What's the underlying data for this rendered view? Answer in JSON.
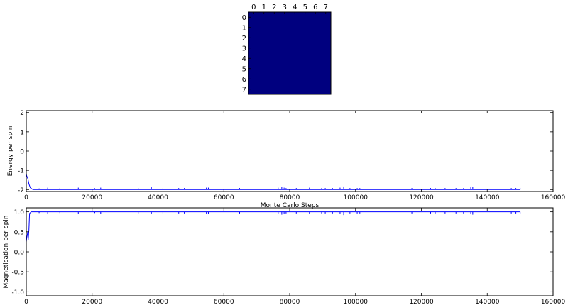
{
  "chart_data": [
    {
      "type": "heatmap",
      "title": "",
      "x_ticks": [
        "0",
        "1",
        "2",
        "3",
        "4",
        "5",
        "6",
        "7"
      ],
      "y_ticks": [
        "0",
        "1",
        "2",
        "3",
        "4",
        "5",
        "6",
        "7"
      ],
      "rows": 8,
      "cols": 8,
      "values": [
        [
          1,
          1,
          1,
          1,
          1,
          1,
          1,
          1
        ],
        [
          1,
          1,
          1,
          1,
          1,
          1,
          1,
          1
        ],
        [
          1,
          1,
          1,
          1,
          1,
          1,
          1,
          1
        ],
        [
          1,
          1,
          1,
          1,
          1,
          1,
          1,
          1
        ],
        [
          1,
          1,
          1,
          1,
          1,
          1,
          1,
          1
        ],
        [
          1,
          1,
          1,
          1,
          1,
          1,
          1,
          1
        ],
        [
          1,
          1,
          1,
          1,
          1,
          1,
          1,
          1
        ],
        [
          1,
          1,
          1,
          1,
          1,
          1,
          1,
          1
        ]
      ],
      "cell_color": "#00007f",
      "x_ticks_position": "top"
    },
    {
      "type": "line",
      "title": "",
      "xlabel": "Monte Carlo Steps",
      "ylabel": "Energy per spin",
      "xlim": [
        0,
        160000
      ],
      "ylim": [
        -2.1,
        2.1
      ],
      "x_ticks": [
        0,
        20000,
        40000,
        60000,
        80000,
        100000,
        120000,
        140000,
        160000
      ],
      "y_ticks": [
        -2,
        -1,
        0,
        1,
        2
      ],
      "line_color": "#0000ff",
      "series": [
        {
          "x": [
            0,
            150,
            300,
            500,
            800,
            1200,
            2000,
            3000,
            150000
          ],
          "values": [
            -1.2,
            -1.3,
            -1.35,
            -1.45,
            -1.7,
            -1.9,
            -2.0,
            -2.0,
            -2.0
          ]
        }
      ],
      "spikes": [
        {
          "x": 3900,
          "y": -1.94
        },
        {
          "x": 6500,
          "y": -1.9
        },
        {
          "x": 10200,
          "y": -1.93
        },
        {
          "x": 12400,
          "y": -1.92
        },
        {
          "x": 15800,
          "y": -1.9
        },
        {
          "x": 20800,
          "y": -1.93
        },
        {
          "x": 22600,
          "y": -1.9
        },
        {
          "x": 34000,
          "y": -1.92
        },
        {
          "x": 38000,
          "y": -1.88
        },
        {
          "x": 41500,
          "y": -1.92
        },
        {
          "x": 46300,
          "y": -1.92
        },
        {
          "x": 48000,
          "y": -1.92
        },
        {
          "x": 54700,
          "y": -1.9
        },
        {
          "x": 55300,
          "y": -1.9
        },
        {
          "x": 64800,
          "y": -1.92
        },
        {
          "x": 76500,
          "y": -1.9
        },
        {
          "x": 77600,
          "y": -1.86
        },
        {
          "x": 78300,
          "y": -1.9
        },
        {
          "x": 78900,
          "y": -1.92
        },
        {
          "x": 82000,
          "y": -1.92
        },
        {
          "x": 86000,
          "y": -1.9
        },
        {
          "x": 88300,
          "y": -1.92
        },
        {
          "x": 89700,
          "y": -1.92
        },
        {
          "x": 90800,
          "y": -1.92
        },
        {
          "x": 93000,
          "y": -1.92
        },
        {
          "x": 95300,
          "y": -1.9
        },
        {
          "x": 96400,
          "y": -1.84
        },
        {
          "x": 98300,
          "y": -1.92
        },
        {
          "x": 100500,
          "y": -1.92
        },
        {
          "x": 101300,
          "y": -1.92
        },
        {
          "x": 117100,
          "y": -1.92
        },
        {
          "x": 122800,
          "y": -1.92
        },
        {
          "x": 124200,
          "y": -1.92
        },
        {
          "x": 127200,
          "y": -1.92
        },
        {
          "x": 130500,
          "y": -1.92
        },
        {
          "x": 132800,
          "y": -1.92
        },
        {
          "x": 135000,
          "y": -1.88
        },
        {
          "x": 135600,
          "y": -1.86
        },
        {
          "x": 147300,
          "y": -1.92
        },
        {
          "x": 148700,
          "y": -1.92
        },
        {
          "x": 150000,
          "y": -1.92
        }
      ]
    },
    {
      "type": "line",
      "title": "",
      "xlabel": "Monte Carlo Steps",
      "ylabel": "Magnetisation per spin",
      "xlim": [
        0,
        160000
      ],
      "ylim": [
        -1.1,
        1.1
      ],
      "x_ticks": [
        0,
        20000,
        40000,
        60000,
        80000,
        100000,
        120000,
        140000,
        160000
      ],
      "y_ticks": [
        -1.0,
        -0.5,
        0.0,
        0.5,
        1.0
      ],
      "y_tick_labels": [
        "-1.0",
        "-0.5",
        "0.0",
        "0.5",
        "1.0"
      ],
      "line_color": "#0000ff",
      "series": [
        {
          "x": [
            0,
            150,
            300,
            450,
            600,
            800,
            1000,
            1500,
            2000,
            150000
          ],
          "values": [
            0.25,
            0.35,
            0.42,
            0.5,
            0.3,
            0.55,
            0.96,
            1.0,
            1.0,
            1.0
          ]
        }
      ],
      "spikes": [
        {
          "x": 3900,
          "y": 0.97
        },
        {
          "x": 6500,
          "y": 0.95
        },
        {
          "x": 10200,
          "y": 0.97
        },
        {
          "x": 12400,
          "y": 0.96
        },
        {
          "x": 15800,
          "y": 0.95
        },
        {
          "x": 20800,
          "y": 0.97
        },
        {
          "x": 22600,
          "y": 0.95
        },
        {
          "x": 34000,
          "y": 0.96
        },
        {
          "x": 38000,
          "y": 0.94
        },
        {
          "x": 41500,
          "y": 0.96
        },
        {
          "x": 46300,
          "y": 0.96
        },
        {
          "x": 48000,
          "y": 0.96
        },
        {
          "x": 54700,
          "y": 0.95
        },
        {
          "x": 55300,
          "y": 0.95
        },
        {
          "x": 64800,
          "y": 0.96
        },
        {
          "x": 76500,
          "y": 0.95
        },
        {
          "x": 77600,
          "y": 0.93
        },
        {
          "x": 78300,
          "y": 0.95
        },
        {
          "x": 78900,
          "y": 0.96
        },
        {
          "x": 82000,
          "y": 0.96
        },
        {
          "x": 86000,
          "y": 0.95
        },
        {
          "x": 88300,
          "y": 0.96
        },
        {
          "x": 89700,
          "y": 0.96
        },
        {
          "x": 90800,
          "y": 0.96
        },
        {
          "x": 93000,
          "y": 0.96
        },
        {
          "x": 95300,
          "y": 0.95
        },
        {
          "x": 96400,
          "y": 0.92
        },
        {
          "x": 98300,
          "y": 0.96
        },
        {
          "x": 100500,
          "y": 0.96
        },
        {
          "x": 101300,
          "y": 0.96
        },
        {
          "x": 117100,
          "y": 0.96
        },
        {
          "x": 122800,
          "y": 0.96
        },
        {
          "x": 124200,
          "y": 0.96
        },
        {
          "x": 127200,
          "y": 0.96
        },
        {
          "x": 130500,
          "y": 0.96
        },
        {
          "x": 132800,
          "y": 0.96
        },
        {
          "x": 135000,
          "y": 0.94
        },
        {
          "x": 135600,
          "y": 0.93
        },
        {
          "x": 147300,
          "y": 0.96
        },
        {
          "x": 148700,
          "y": 0.96
        },
        {
          "x": 150000,
          "y": 0.96
        }
      ]
    }
  ]
}
